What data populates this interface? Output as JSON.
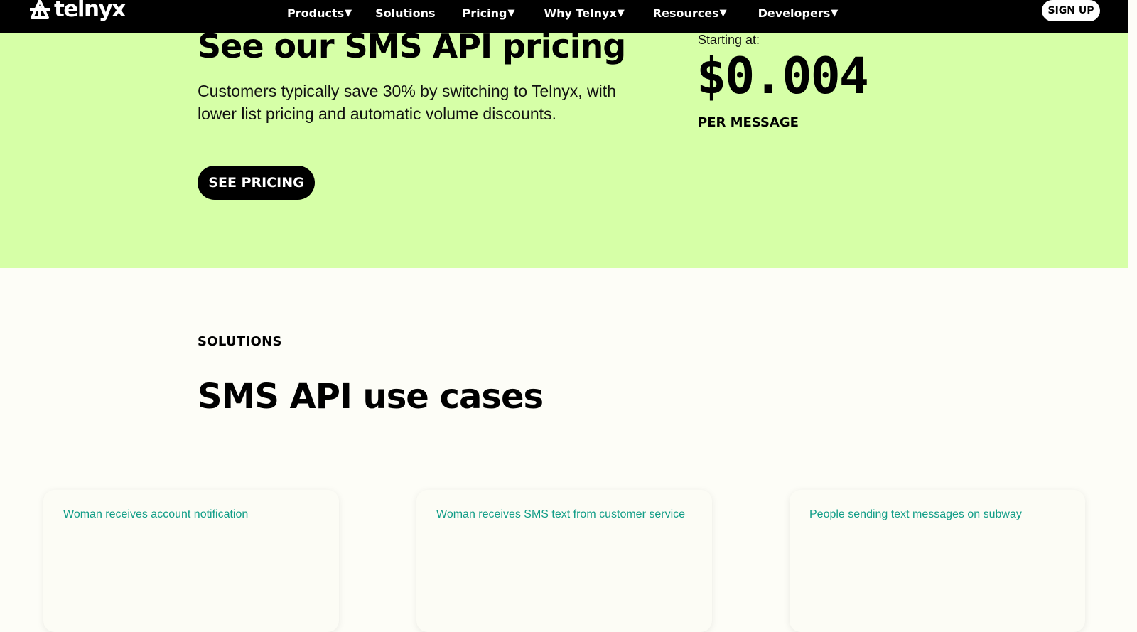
{
  "nav": {
    "logo_text": "telnyx",
    "items": [
      {
        "label": "Products",
        "has_dropdown": true
      },
      {
        "label": "Solutions",
        "has_dropdown": false
      },
      {
        "label": "Pricing",
        "has_dropdown": true
      },
      {
        "label": "Why Telnyx",
        "has_dropdown": true
      },
      {
        "label": "Resources",
        "has_dropdown": true
      },
      {
        "label": "Developers",
        "has_dropdown": true
      }
    ],
    "caret": "▼",
    "signup_label": "SIGN UP"
  },
  "hero": {
    "title": "See our SMS API pricing",
    "description": "Customers typically save 30% by switching to Telnyx, with lower list pricing and automatic volume discounts.",
    "cta_label": "SEE PRICING",
    "starting_at": "Starting at:",
    "price": "$0.004",
    "price_unit": "PER MESSAGE"
  },
  "solutions": {
    "label": "SOLUTIONS",
    "title": "SMS API use cases",
    "cards": [
      {
        "alt": "Woman receives account notification"
      },
      {
        "alt": "Woman receives SMS text from customer service"
      },
      {
        "alt": "People sending text messages on subway"
      }
    ]
  },
  "colors": {
    "nav_bg": "#000000",
    "hero_bg": "#d6ffa7",
    "page_bg": "#fdfdf7",
    "card_alt_text": "#119d87"
  }
}
